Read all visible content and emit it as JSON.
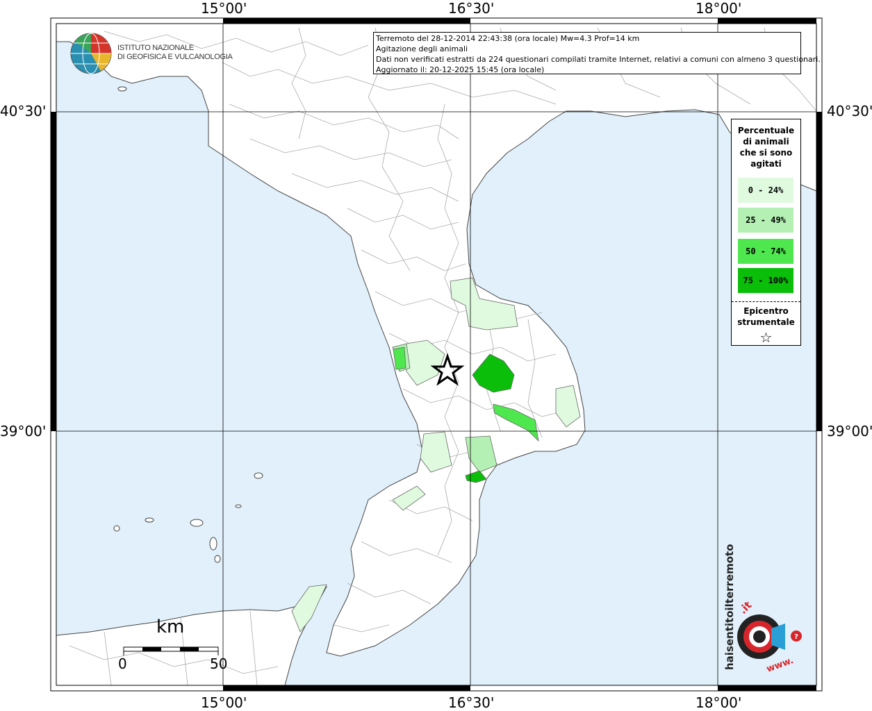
{
  "info_box": {
    "line1": "Terremoto del 28-12-2014 22:43:38 (ora locale) Mw=4.3 Prof=14 km",
    "line2": "Agitazione degli animali",
    "line3": "Dati non verificati estratti da 224 questionari compilati tramite Internet, relativi a comuni con almeno 3 questionari.",
    "line4": "Aggiornato il: 20-12-2025 15:45 (ora locale)"
  },
  "coords": {
    "lon_top_1": "15°00'",
    "lon_top_2": "16°30'",
    "lon_top_3": "18°00'",
    "lon_bottom_1": "15°00'",
    "lon_bottom_2": "16°30'",
    "lon_bottom_3": "18°00'",
    "lat_left_1": "40°30'",
    "lat_left_2": "39°00'",
    "lat_right_1": "40°30'",
    "lat_right_2": "39°00'"
  },
  "ingv": {
    "line1": "ISTITUTO NAZIONALE",
    "line2": "DI GEOFISICA E VULCANOLOGIA"
  },
  "legend": {
    "title_1": "Percentuale",
    "title_2": "di animali",
    "title_3": "che si sono",
    "title_4": "agitati",
    "classes": [
      {
        "label": "0 - 24%",
        "color": "#e0fae0"
      },
      {
        "label": "25 - 49%",
        "color": "#b4f0b4"
      },
      {
        "label": "50 - 74%",
        "color": "#4ee84e"
      },
      {
        "label": "75 - 100%",
        "color": "#0abe0a"
      }
    ],
    "epicenter_1": "Epicentro",
    "epicenter_2": "strumentale",
    "epicenter_symbol": "☆"
  },
  "scale": {
    "unit": "km",
    "min": "0",
    "max": "50"
  },
  "logo": {
    "text_1": "haisentitoilterremoto",
    "text_2": ".it",
    "text_3": "www."
  },
  "colors": {
    "sea": "#e1f0fa",
    "land": "#ffffff",
    "border": "#999999",
    "frame": "#000000"
  },
  "icons": [
    "ingv-globe-logo",
    "haisentitoilterremoto-logo",
    "epicenter-star-icon"
  ]
}
